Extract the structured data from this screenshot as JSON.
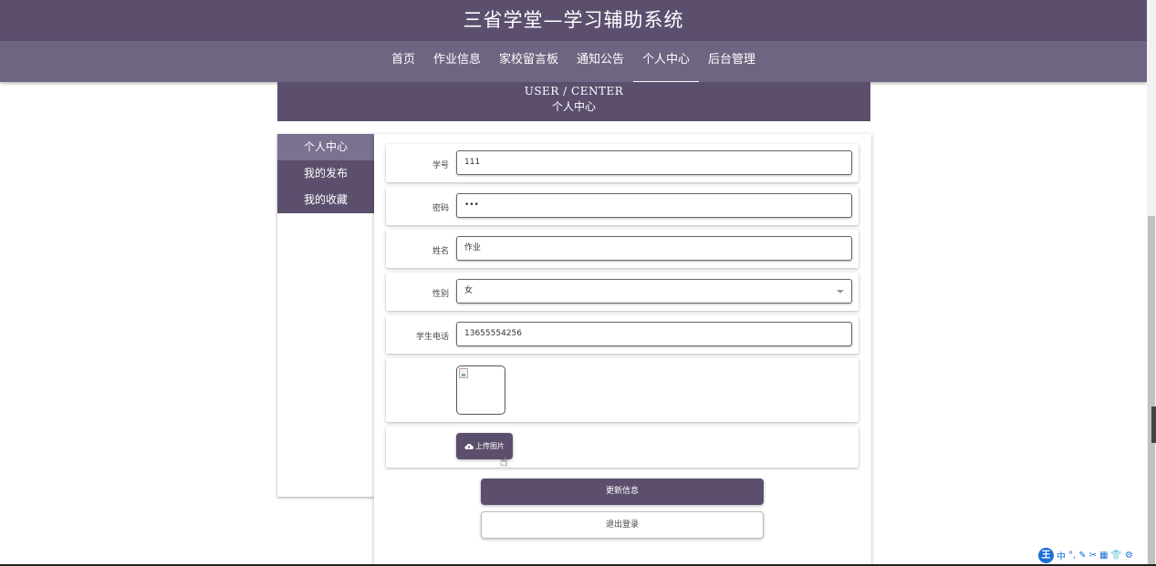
{
  "header": {
    "site_title": "三省学堂—学习辅助系统"
  },
  "nav": {
    "items": [
      {
        "label": "首页",
        "active": false
      },
      {
        "label": "作业信息",
        "active": false
      },
      {
        "label": "家校留言板",
        "active": false
      },
      {
        "label": "通知公告",
        "active": false
      },
      {
        "label": "个人中心",
        "active": true
      },
      {
        "label": "后台管理",
        "active": false
      }
    ]
  },
  "center_header": {
    "title_en": "USER / CENTER",
    "title_cn": "个人中心"
  },
  "sidebar": {
    "items": [
      {
        "label": "个人中心",
        "active": true
      },
      {
        "label": "我的发布",
        "active": false
      },
      {
        "label": "我的收藏",
        "active": false
      }
    ]
  },
  "form": {
    "student_id": {
      "label": "学号",
      "value": "111"
    },
    "password": {
      "label": "密码",
      "value": "•••"
    },
    "name": {
      "label": "姓名",
      "value": "作业"
    },
    "gender": {
      "label": "性别",
      "value": "女"
    },
    "phone": {
      "label": "学生电话",
      "value": "13655554256"
    },
    "upload_label": "上传图片",
    "update_label": "更新信息",
    "logout_label": "退出登录"
  },
  "ime": {
    "logo": "王",
    "mode": "中",
    "tools": [
      "°,",
      "✎",
      "✂",
      "▦",
      "👕",
      "⚙"
    ]
  },
  "colors": {
    "primary": "#5c4f6e",
    "nav_bg": "#6e6582",
    "sidebar_active": "#7b7190"
  }
}
